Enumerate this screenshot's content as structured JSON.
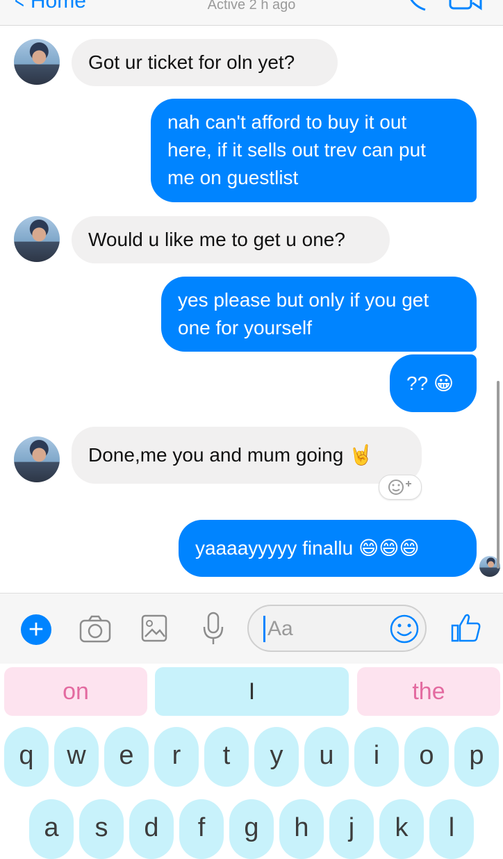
{
  "header": {
    "back_label": "Home",
    "status": "Active 2 h ago"
  },
  "messages": [
    {
      "from": "them",
      "text": "Got ur ticket for oln yet?"
    },
    {
      "from": "me",
      "text": "nah can't afford to buy it out\nhere, if it sells out trev can put\nme on guestlist"
    },
    {
      "from": "them",
      "text": "Would u like me to get u one?"
    },
    {
      "from": "me",
      "text": "yes please but only if you get\none for yourself"
    },
    {
      "from": "me",
      "text": "?? 😀"
    },
    {
      "from": "them",
      "text": "Done,me you and mum going 🤘"
    },
    {
      "from": "me",
      "text": "yaaaayyyyy finallu 😄😄😄"
    }
  ],
  "composer": {
    "placeholder": "Aa"
  },
  "keyboard": {
    "suggestions": [
      "on",
      "I",
      "the"
    ],
    "row1": [
      "q",
      "w",
      "e",
      "r",
      "t",
      "y",
      "u",
      "i",
      "o",
      "p"
    ],
    "row2": [
      "a",
      "s",
      "d",
      "f",
      "g",
      "h",
      "j",
      "k",
      "l"
    ]
  },
  "colors": {
    "accent": "#0084ff",
    "incoming_bubble": "#f1f0f0",
    "key_bg": "#c8f2fb",
    "suggestion_pink": "#fde3ef",
    "suggestion_blue": "#c8f2fb"
  }
}
